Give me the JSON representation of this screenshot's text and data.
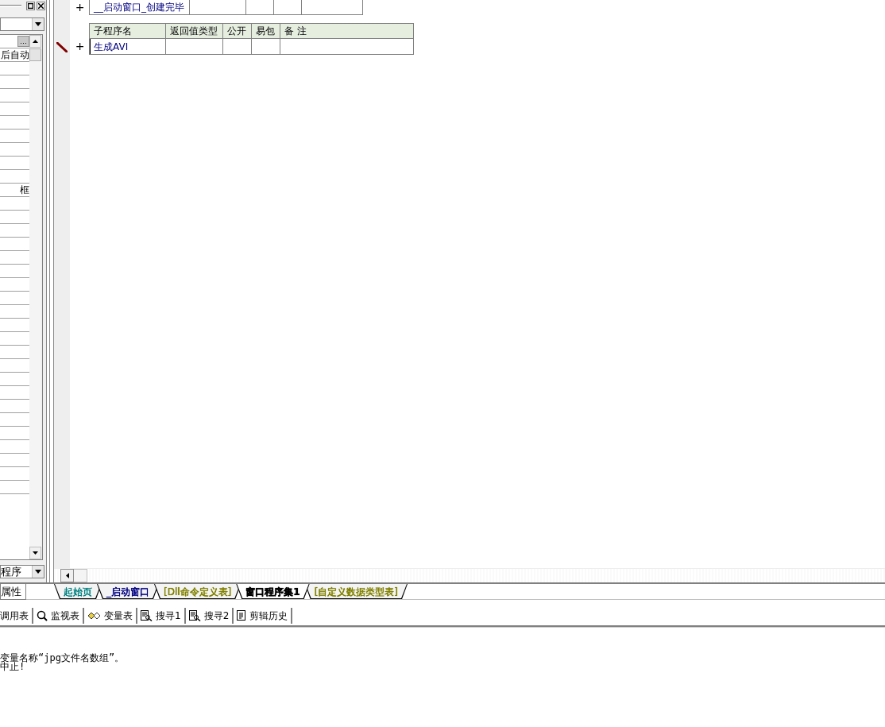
{
  "properties_panel": {
    "rows": [
      {
        "kind": "button",
        "text": "…"
      },
      {
        "kind": "text",
        "text": "后自动"
      },
      {
        "kind": "blank"
      },
      {
        "kind": "blank"
      },
      {
        "kind": "blank"
      },
      {
        "kind": "blank"
      },
      {
        "kind": "blank"
      },
      {
        "kind": "blank"
      },
      {
        "kind": "blank"
      },
      {
        "kind": "blank"
      },
      {
        "kind": "blank"
      },
      {
        "kind": "text",
        "text": "框"
      },
      {
        "kind": "blank"
      },
      {
        "kind": "blank"
      },
      {
        "kind": "blank"
      },
      {
        "kind": "blank"
      },
      {
        "kind": "blank"
      },
      {
        "kind": "blank"
      },
      {
        "kind": "blank"
      },
      {
        "kind": "blank"
      },
      {
        "kind": "blank"
      },
      {
        "kind": "blank"
      },
      {
        "kind": "blank"
      },
      {
        "kind": "blank"
      },
      {
        "kind": "blank"
      },
      {
        "kind": "blank"
      },
      {
        "kind": "blank"
      },
      {
        "kind": "blank"
      },
      {
        "kind": "blank"
      },
      {
        "kind": "blank"
      },
      {
        "kind": "blank"
      },
      {
        "kind": "blank"
      },
      {
        "kind": "blank"
      },
      {
        "kind": "blank"
      }
    ],
    "bottom_dropdown": "程序",
    "tab": "属性"
  },
  "editor": {
    "event_row": {
      "expander": "+",
      "name": "__启动窗口_创建完毕"
    },
    "sub_table": {
      "columns": [
        "子程序名",
        "返回值类型",
        "公开",
        "易包",
        "备 注"
      ],
      "rows": [
        {
          "expander": "+",
          "name": "生成AVI",
          "current": true
        }
      ]
    }
  },
  "tabs": [
    {
      "label": "起始页",
      "color": "#008080",
      "selected": false
    },
    {
      "label": "_启动窗口",
      "color": "#000080",
      "selected": false
    },
    {
      "label": "[Dll命令定义表]",
      "color": "#808000",
      "selected": false
    },
    {
      "label": "窗口程序集1",
      "color": "#000000",
      "selected": true
    },
    {
      "label": "[自定义数据类型表]",
      "color": "#808000",
      "selected": false
    }
  ],
  "toolbar": [
    {
      "kind": "none",
      "label": "调用表"
    },
    {
      "kind": "magnifier",
      "label": "监视表"
    },
    {
      "kind": "variables",
      "label": "变量表"
    },
    {
      "kind": "search",
      "label": "搜寻1"
    },
    {
      "kind": "search",
      "label": "搜寻2"
    },
    {
      "kind": "history",
      "label": "剪辑历史"
    }
  ],
  "output": [
    "变量名称“jpg文件名数组”。",
    "中止!"
  ]
}
